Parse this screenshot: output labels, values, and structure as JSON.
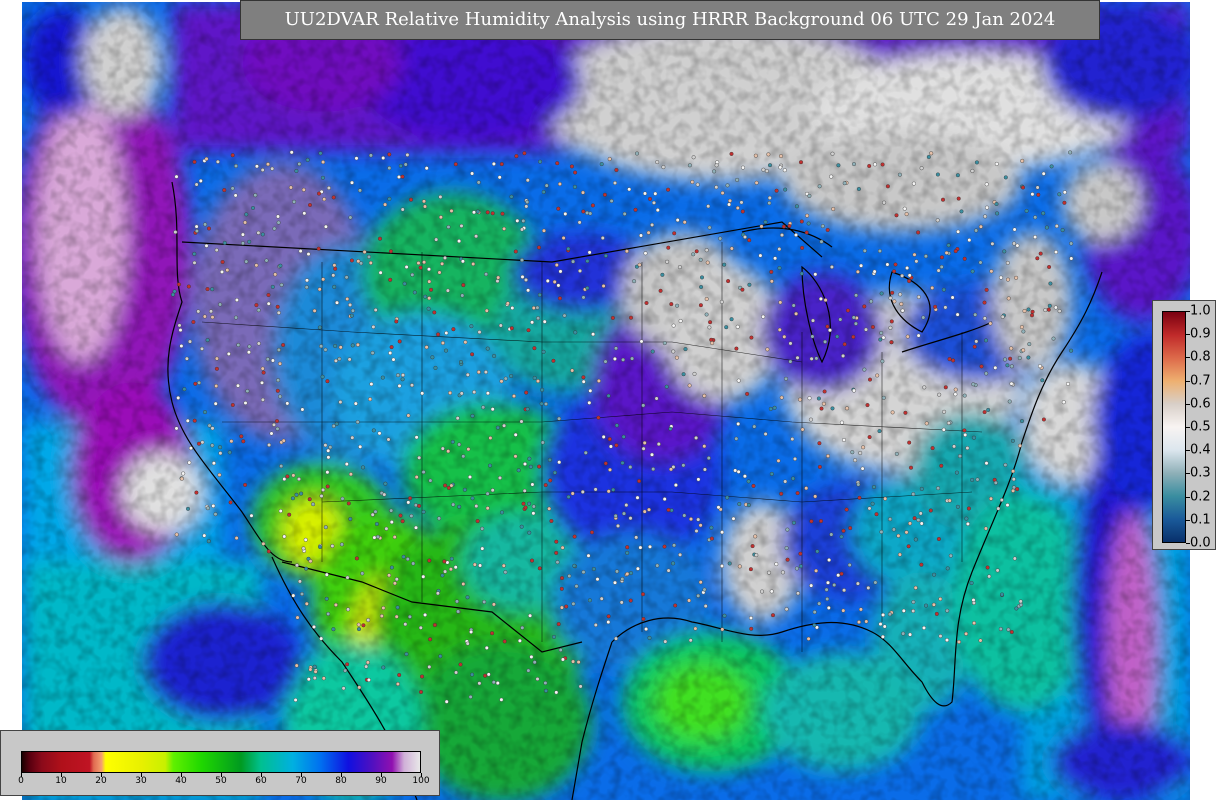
{
  "title": "UU2DVAR Relative Humidity Analysis using HRRR Background 06 UTC 29 Jan 2024",
  "colors": {
    "background_panel": "#c8c8c8",
    "title_bg": "#7f7f7f",
    "title_text": "#ffffff",
    "boundary": "#000000",
    "no_data_gray": "#cfcfcf"
  },
  "humidity_colorbar": {
    "min": 0,
    "max": 100,
    "tick_labels": [
      "0",
      "10",
      "20",
      "30",
      "40",
      "50",
      "60",
      "70",
      "80",
      "90",
      "100"
    ],
    "stops": [
      {
        "v": 0,
        "c": "#1a0000"
      },
      {
        "v": 2,
        "c": "#5a0010"
      },
      {
        "v": 5,
        "c": "#8b0a1a"
      },
      {
        "v": 10,
        "c": "#b0101a"
      },
      {
        "v": 17,
        "c": "#c01424"
      },
      {
        "v": 18,
        "c": "#e06a50"
      },
      {
        "v": 20,
        "c": "#f5a070"
      },
      {
        "v": 21,
        "c": "#ffff00"
      },
      {
        "v": 30,
        "c": "#e8f000"
      },
      {
        "v": 36,
        "c": "#c8f000"
      },
      {
        "v": 38,
        "c": "#60f000"
      },
      {
        "v": 45,
        "c": "#20d800"
      },
      {
        "v": 55,
        "c": "#009a20"
      },
      {
        "v": 60,
        "c": "#00c090"
      },
      {
        "v": 68,
        "c": "#00b0e0"
      },
      {
        "v": 75,
        "c": "#0070f0"
      },
      {
        "v": 82,
        "c": "#1010e0"
      },
      {
        "v": 88,
        "c": "#5010c0"
      },
      {
        "v": 93,
        "c": "#9010b0"
      },
      {
        "v": 96,
        "c": "#d0b0d8"
      },
      {
        "v": 100,
        "c": "#e8e8e8"
      }
    ]
  },
  "difference_colorbar": {
    "min": 0.0,
    "max": 1.0,
    "tick_labels": [
      "1.0",
      "0.9",
      "0.8",
      "0.7",
      "0.6",
      "0.5",
      "0.4",
      "0.3",
      "0.2",
      "0.1",
      "0.0"
    ],
    "stops": [
      {
        "v": 0.0,
        "c": "#08306b"
      },
      {
        "v": 0.1,
        "c": "#1a5a9a"
      },
      {
        "v": 0.2,
        "c": "#3a8ea0"
      },
      {
        "v": 0.3,
        "c": "#8fb0b8"
      },
      {
        "v": 0.4,
        "c": "#dce6ee"
      },
      {
        "v": 0.5,
        "c": "#f8f4f2"
      },
      {
        "v": 0.6,
        "c": "#d8cfc8"
      },
      {
        "v": 0.7,
        "c": "#eeb070"
      },
      {
        "v": 0.8,
        "c": "#dd6a4a"
      },
      {
        "v": 0.9,
        "c": "#c02a2a"
      },
      {
        "v": 1.0,
        "c": "#7a0010"
      }
    ]
  },
  "map": {
    "projection": "Lambert Conformal (HRRR CONUS domain)",
    "features": [
      "coastlines",
      "state-boundaries",
      "country-boundaries",
      "great-lakes",
      "observation-stations"
    ]
  }
}
